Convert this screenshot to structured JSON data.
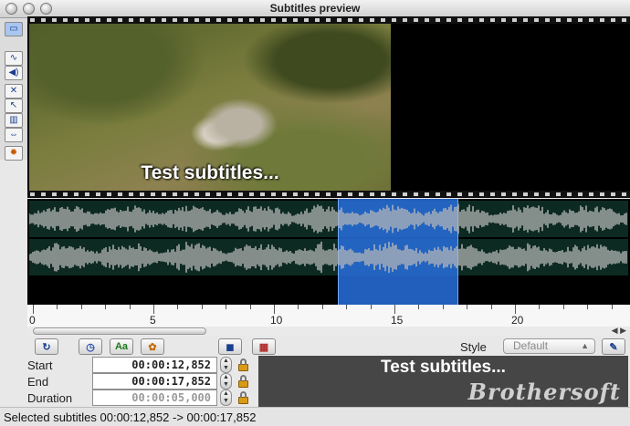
{
  "window": {
    "title": "Subtitles preview"
  },
  "left_toolbar": {
    "buttons": [
      {
        "name": "monitor-icon",
        "glyph": "▭",
        "active": true
      },
      {
        "name": "waveform-view-icon",
        "glyph": "∿",
        "active": false
      },
      {
        "name": "speaker-icon",
        "glyph": "◀)",
        "active": false
      },
      {
        "name": "magic-wand-icon",
        "glyph": "✕",
        "active": false
      },
      {
        "name": "pointer-icon",
        "glyph": "↖",
        "active": false
      },
      {
        "name": "ruler-icon",
        "glyph": "▥",
        "active": false
      },
      {
        "name": "stretch-icon",
        "glyph": "⇔",
        "active": false
      },
      {
        "name": "picture-icon",
        "glyph": "✹",
        "active": false
      }
    ]
  },
  "video": {
    "subtitle": "Test subtitles..."
  },
  "timeline": {
    "ticks": [
      "0",
      "5",
      "10",
      "15",
      "20"
    ],
    "selection_start_s": 12.852,
    "selection_end_s": 17.852
  },
  "toolbar": {
    "style_label": "Style",
    "style_value": "Default",
    "icons": [
      "refresh-icon",
      "clock-icon",
      "text-style-icon",
      "palette-icon",
      "cube-icon",
      "grid-icon",
      "pen-icon"
    ]
  },
  "fields": {
    "start_label": "Start",
    "start_value": "00:00:12,852",
    "end_label": "End",
    "end_value": "00:00:17,852",
    "duration_label": "Duration",
    "duration_value": "00:00:05,000"
  },
  "preview": {
    "text": "Test subtitles...",
    "watermark": "Brothersoft"
  },
  "status": {
    "text": "Selected subtitles 00:00:12,852 -> 00:00:17,852"
  },
  "colors": {
    "selection": "#286edc",
    "waveform": "#b8b8b8",
    "wave_background": "#0d2a22"
  }
}
